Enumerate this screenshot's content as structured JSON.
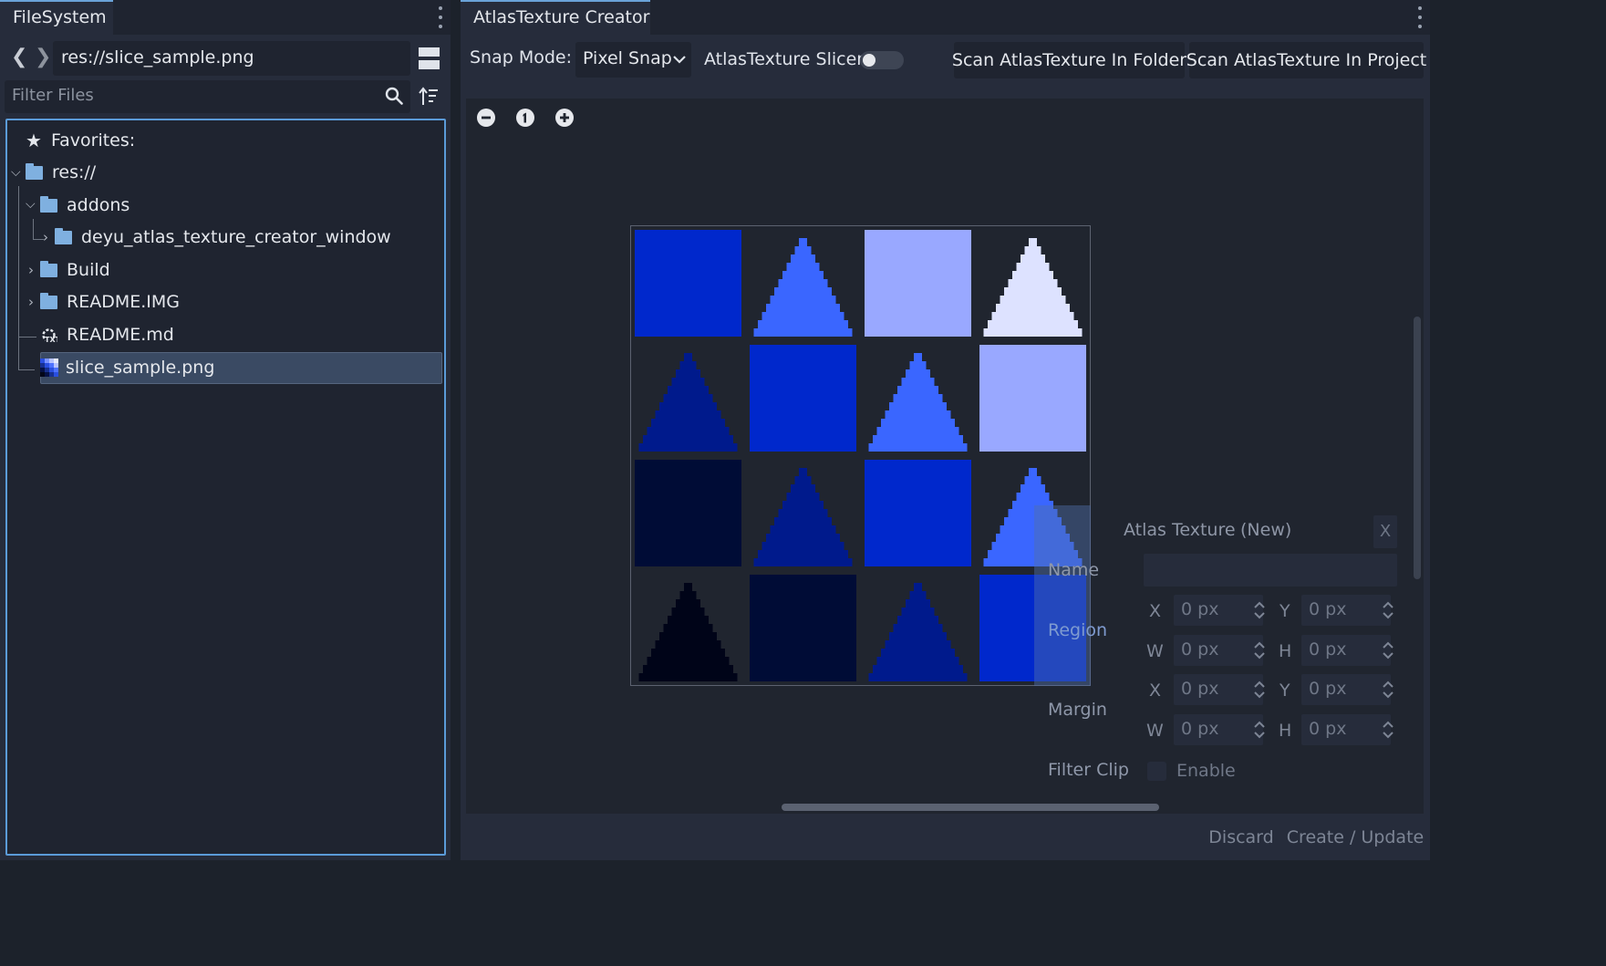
{
  "filesystem": {
    "tab_label": "FileSystem",
    "path": "res://slice_sample.png",
    "filter_placeholder": "Filter Files",
    "tree": {
      "favorites": "Favorites:",
      "root": "res://",
      "addons": "addons",
      "window_folder": "deyu_atlas_texture_creator_window",
      "build": "Build",
      "readme_img": "README.IMG",
      "readme_md": "README.md",
      "selected_file": "slice_sample.png"
    }
  },
  "creator": {
    "tab_label": "AtlasTexture Creator",
    "snap_mode_label": "Snap Mode:",
    "snap_mode_value": "Pixel Snap",
    "slicer_label": "AtlasTexture Slicer",
    "slicer_enabled": false,
    "scan_folder_button": "Scan AtlasTexture In Folder",
    "scan_project_button": "Scan AtlasTexture In Project",
    "discard_button": "Discard",
    "create_button": "Create / Update"
  },
  "atlas_grid": {
    "rows": [
      [
        {
          "shape": "square",
          "color": "#0028cc"
        },
        {
          "shape": "triangle",
          "color": "#3a66ff"
        },
        {
          "shape": "square",
          "color": "#99a8ff"
        },
        {
          "shape": "triangle",
          "color": "#dde2ff"
        }
      ],
      [
        {
          "shape": "triangle",
          "color": "#001a8c"
        },
        {
          "shape": "square",
          "color": "#0028cc"
        },
        {
          "shape": "triangle",
          "color": "#3a66ff"
        },
        {
          "shape": "square",
          "color": "#99a8ff"
        }
      ],
      [
        {
          "shape": "square",
          "color": "#000c36"
        },
        {
          "shape": "triangle",
          "color": "#001a8c"
        },
        {
          "shape": "square",
          "color": "#0028cc"
        },
        {
          "shape": "triangle",
          "color": "#3a66ff"
        }
      ],
      [
        {
          "shape": "triangle",
          "color": "#000418"
        },
        {
          "shape": "square",
          "color": "#000c36"
        },
        {
          "shape": "triangle",
          "color": "#001a8c"
        },
        {
          "shape": "square",
          "color": "#0028cc"
        }
      ]
    ]
  },
  "inspector": {
    "title": "Atlas Texture",
    "status": "(New)",
    "close_label": "X",
    "name_label": "Name",
    "region_label": "Region",
    "margin_label": "Margin",
    "filter_clip_label": "Filter Clip",
    "enable_label": "Enable",
    "axis": {
      "x": "X",
      "y": "Y",
      "w": "W",
      "h": "H"
    },
    "region": {
      "x": "0 px",
      "y": "0 px",
      "w": "0 px",
      "h": "0 px"
    },
    "margin": {
      "x": "0 px",
      "y": "0 px",
      "w": "0 px",
      "h": "0 px"
    }
  }
}
